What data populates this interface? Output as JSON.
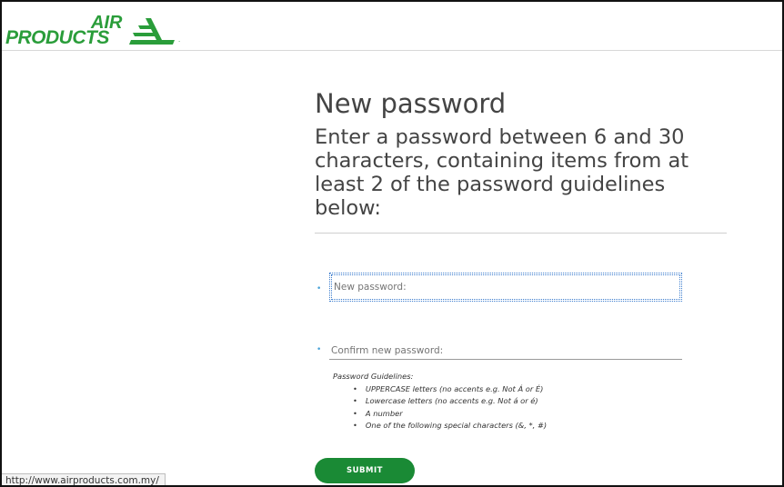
{
  "header": {
    "logo_air": "AIR",
    "logo_products": "PRODUCTS",
    "logo_tm": "."
  },
  "main": {
    "title": "New password",
    "subtitle": "Enter a password between 6 and 30 characters, containing items from at least 2 of the password guidelines below:"
  },
  "form": {
    "new_password_placeholder": "New password:",
    "confirm_password_placeholder": "Confirm new password:",
    "guidelines_heading": "Password Guidelines:",
    "guidelines": [
      "UPPERCASE letters (no accents e.g. Not Á or É)",
      "Lowercase letters (no accents e.g. Not á or é)",
      "A number",
      "One of the following special characters (&, *, #)"
    ],
    "submit_label": "SUBMIT"
  },
  "status_bar": {
    "url": "http://www.airproducts.com.my/"
  },
  "colors": {
    "brand_green": "#2a9d3a",
    "button_green": "#1a8a35",
    "focus_blue": "#3f7fcf"
  }
}
